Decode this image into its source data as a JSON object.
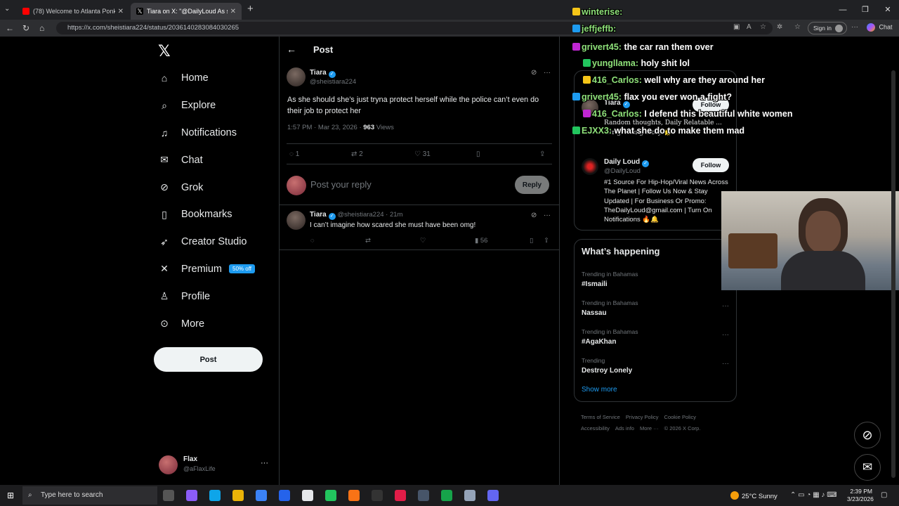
{
  "browser": {
    "tabs": [
      {
        "title": "(78) Welcome to Atlanta Ponks | Y",
        "icon": "youtube-icon",
        "color": "#ff0000"
      },
      {
        "title": "Tiara on X: \"@DailyLoud As she s",
        "icon": "x-icon",
        "color": "#ffffff"
      }
    ],
    "url": "https://x.com/sheistiara224/status/2036140283084030265",
    "signin_label": "Sign in",
    "chat_label": "Chat"
  },
  "x": {
    "nav": [
      {
        "label": "Home",
        "icon": "home-icon",
        "glyph": "⌂"
      },
      {
        "label": "Explore",
        "icon": "search-icon",
        "glyph": "⌕"
      },
      {
        "label": "Notifications",
        "icon": "bell-icon",
        "glyph": "♫"
      },
      {
        "label": "Chat",
        "icon": "mail-icon",
        "glyph": "✉"
      },
      {
        "label": "Grok",
        "icon": "grok-icon",
        "glyph": "⊘"
      },
      {
        "label": "Bookmarks",
        "icon": "bookmark-icon",
        "glyph": "▯"
      },
      {
        "label": "Creator Studio",
        "icon": "rocket-icon",
        "glyph": "➶"
      },
      {
        "label": "Premium",
        "icon": "x-premium-icon",
        "glyph": "✕"
      },
      {
        "label": "Profile",
        "icon": "person-icon",
        "glyph": "♙"
      },
      {
        "label": "More",
        "icon": "more-circle-icon",
        "glyph": "⊙"
      }
    ],
    "premium_badge": "50% off",
    "post_button": "Post",
    "account": {
      "name": "Flax",
      "handle": "@aFlaxLife"
    }
  },
  "post": {
    "header": "Post",
    "author": "Tiara",
    "handle": "@sheistiara224",
    "text": "As she should she’s just tryna protect herself while the police can’t even do their job to protect her",
    "time": "1:57 PM · Mar 23, 2026 · ",
    "views": "963",
    "views_label": " Views",
    "replies": "1",
    "reposts": "2",
    "likes": "31",
    "reply_placeholder": "Post your reply",
    "reply_button": "Reply"
  },
  "comment": {
    "author": "Tiara",
    "handle": " @sheistiara224 · 21m",
    "text": "I can’t imagine how scared she must have been omg!",
    "views": "56"
  },
  "sidebar": {
    "who_to_follow": [
      {
        "name": "Tiara",
        "follow": "Follow"
      },
      {
        "name": "Daily Loud",
        "handle": "@DailyLoud",
        "follow": "Follow",
        "bio": "#1 Source For Hip-Hop/Viral News Across The Planet | Follow Us Now & Stay Updated | For Business Or Promo: TheDailyLoud@gmail.com | Turn On Notifications 🔥🔔"
      }
    ],
    "tiara_bio": "Random thoughts, Daily Relatable ... our growing story 🌟",
    "trends_title": "What’s happening",
    "trends": [
      {
        "context": "Trending in Bahamas",
        "name": "#Ismaili"
      },
      {
        "context": "Trending in Bahamas",
        "name": "Nassau"
      },
      {
        "context": "Trending in Bahamas",
        "name": "#AgaKhan"
      },
      {
        "context": "Trending",
        "name": "Destroy Lonely"
      }
    ],
    "show_more": "Show more",
    "footer": [
      "Terms of Service",
      "Privacy Policy",
      "Cookie Policy",
      "Accessibility",
      "Ads info",
      "More ···",
      "© 2026 X Corp."
    ]
  },
  "stream_chat": [
    {
      "user": "winterise:",
      "msg": ""
    },
    {
      "user": "jeffjeffb:",
      "msg": ""
    },
    {
      "user": "grivert45:",
      "msg": "the car ran them over"
    },
    {
      "user": "yungllama:",
      "msg": "holy shit lol"
    },
    {
      "user": "416_Carlos:",
      "msg": "well why are they around her"
    },
    {
      "user": "grivert45:",
      "msg": "flax you ever won a fight?"
    },
    {
      "user": "416_Carlos:",
      "msg": "I defend this beautiful white women"
    },
    {
      "user": "EJXX3:",
      "msg": "what she do to make them mad"
    }
  ],
  "taskbar": {
    "search_placeholder": "Type here to search",
    "weather": "25°C  Sunny",
    "time": "2:39 PM",
    "date": "3/23/2026"
  }
}
